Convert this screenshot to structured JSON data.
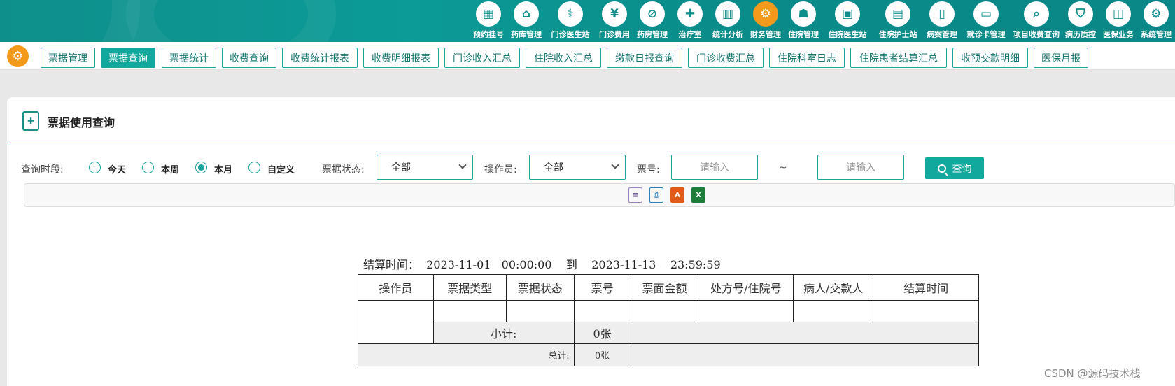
{
  "top_nav": [
    {
      "label": "预约挂号",
      "icon": "calendar-icon",
      "glyph": "▦"
    },
    {
      "label": "药库管理",
      "icon": "warehouse-icon",
      "glyph": "⌂"
    },
    {
      "label": "门诊医生站",
      "icon": "doctor-icon",
      "glyph": "⚕"
    },
    {
      "label": "门诊费用",
      "icon": "yen-icon",
      "glyph": "¥"
    },
    {
      "label": "药房管理",
      "icon": "pill-icon",
      "glyph": "⊘"
    },
    {
      "label": "治疗室",
      "icon": "nurse-icon",
      "glyph": "✚"
    },
    {
      "label": "统计分析",
      "icon": "chart-icon",
      "glyph": "▥"
    },
    {
      "label": "财务管理",
      "icon": "finance-gear-icon",
      "glyph": "⚙",
      "active": true
    },
    {
      "label": "住院管理",
      "icon": "bed-icon",
      "glyph": "☗"
    },
    {
      "label": "住院医生站",
      "icon": "id-card-icon",
      "glyph": "▣"
    },
    {
      "label": "住院护士站",
      "icon": "nurse-card-icon",
      "glyph": "▤"
    },
    {
      "label": "病案管理",
      "icon": "folder-icon",
      "glyph": "▯"
    },
    {
      "label": "就诊卡管理",
      "icon": "card-icon",
      "glyph": "▭"
    },
    {
      "label": "项目收费查询",
      "icon": "search-doc-icon",
      "glyph": "⌕"
    },
    {
      "label": "病历质控",
      "icon": "shield-icon",
      "glyph": "⛉"
    },
    {
      "label": "医保业务",
      "icon": "insurance-icon",
      "glyph": "◫"
    },
    {
      "label": "系统管理",
      "icon": "settings-icon",
      "glyph": "⚙"
    }
  ],
  "sub_tabs": [
    {
      "label": "票据管理"
    },
    {
      "label": "票据查询",
      "active": true
    },
    {
      "label": "票据统计"
    },
    {
      "label": "收费查询"
    },
    {
      "label": "收费统计报表"
    },
    {
      "label": "收费明细报表"
    },
    {
      "label": "门诊收入汇总"
    },
    {
      "label": "住院收入汇总"
    },
    {
      "label": "缴款日报查询"
    },
    {
      "label": "门诊收费汇总"
    },
    {
      "label": "住院科室日志"
    },
    {
      "label": "住院患者结算汇总"
    },
    {
      "label": "收预交款明细"
    },
    {
      "label": "医保月报"
    }
  ],
  "panel": {
    "title": "票据使用查询"
  },
  "filters": {
    "period_label": "查询时段:",
    "periods": [
      {
        "label": "今天",
        "checked": false
      },
      {
        "label": "本周",
        "checked": false
      },
      {
        "label": "本月",
        "checked": true
      },
      {
        "label": "自定义",
        "checked": false
      }
    ],
    "status_label": "票据状态:",
    "status_value": "全部",
    "operator_label": "操作员:",
    "operator_value": "全部",
    "ticket_no_label": "票号:",
    "ticket_from_placeholder": "请输入",
    "ticket_to_placeholder": "请输入",
    "range_sep": "~",
    "search_label": "查询"
  },
  "toolbar_icons": [
    "preview-icon",
    "print-icon",
    "pdf-export-icon",
    "excel-export-icon"
  ],
  "report": {
    "caption": "结算时间：  2023-11-01   00:00:00    到    2023-11-13    23:59:59",
    "headers": [
      "操作员",
      "票据类型",
      "票据状态",
      "票号",
      "票面金额",
      "处方号/住院号",
      "病人/交款人",
      "结算时间"
    ],
    "subtotal_label": "小计:",
    "subtotal_value": "0张",
    "total_label": "总计:",
    "total_value": "0张"
  },
  "watermark": "CSDN @源码技术栈"
}
